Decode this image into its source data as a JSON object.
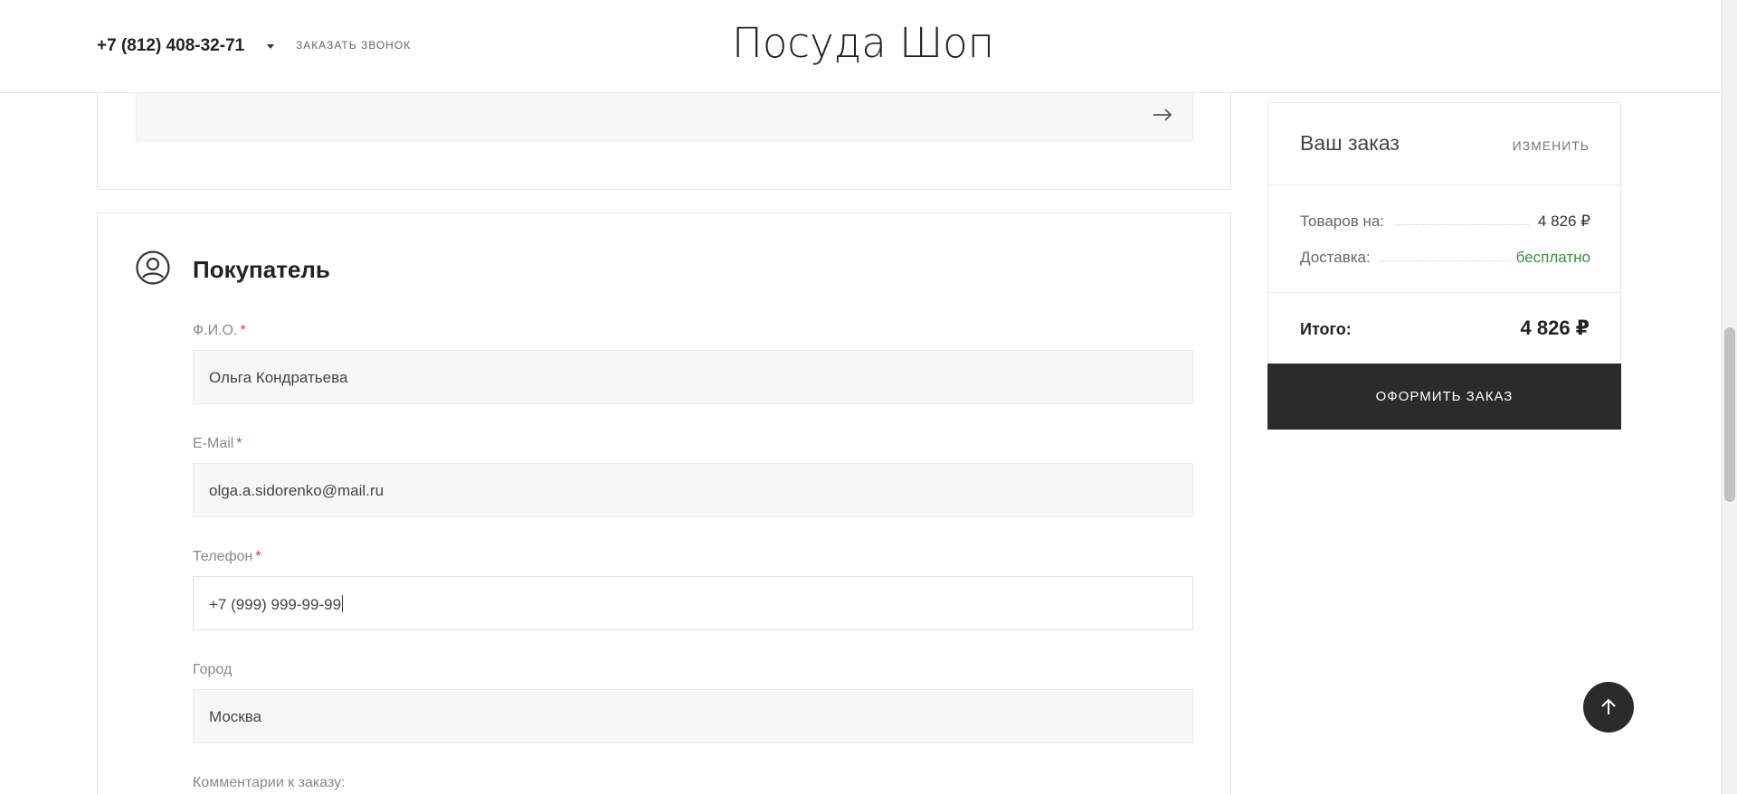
{
  "header": {
    "phone": "+7 (812) 408-32-71",
    "callback_label": "ЗАКАЗАТЬ ЗВОНОК",
    "logo": "Посуда Шоп"
  },
  "address": {
    "submit_icon": "arrow-right-icon"
  },
  "buyer": {
    "icon": "user-circle-icon",
    "title": "Покупатель",
    "required_mark": "*",
    "fields": [
      {
        "label": "Ф.И.О.",
        "value": "Ольга Кондратьева",
        "required": true
      },
      {
        "label": "E-Mail",
        "value": "olga.a.sidorenko@mail.ru",
        "required": true
      },
      {
        "label": "Телефон",
        "value": "+7 (999) 999-99-99",
        "required": true,
        "focused": true
      },
      {
        "label": "Город",
        "value": "Москва",
        "required": false
      }
    ],
    "comment_label": "Комментарии к заказу:"
  },
  "order": {
    "title": "Ваш заказ",
    "edit_label": "ИЗМЕНИТЬ",
    "rows": [
      {
        "label": "Товаров на:",
        "value": "4 826 ₽"
      },
      {
        "label": "Доставка:",
        "value": "бесплатно"
      }
    ],
    "total_label": "Итого:",
    "total_value": "4 826 ₽",
    "submit_label": "ОФОРМИТЬ ЗАКАЗ"
  },
  "colors": {
    "accent_dark": "#2b2b2b",
    "required": "#e53935",
    "free_delivery": "#3a8f3a"
  }
}
